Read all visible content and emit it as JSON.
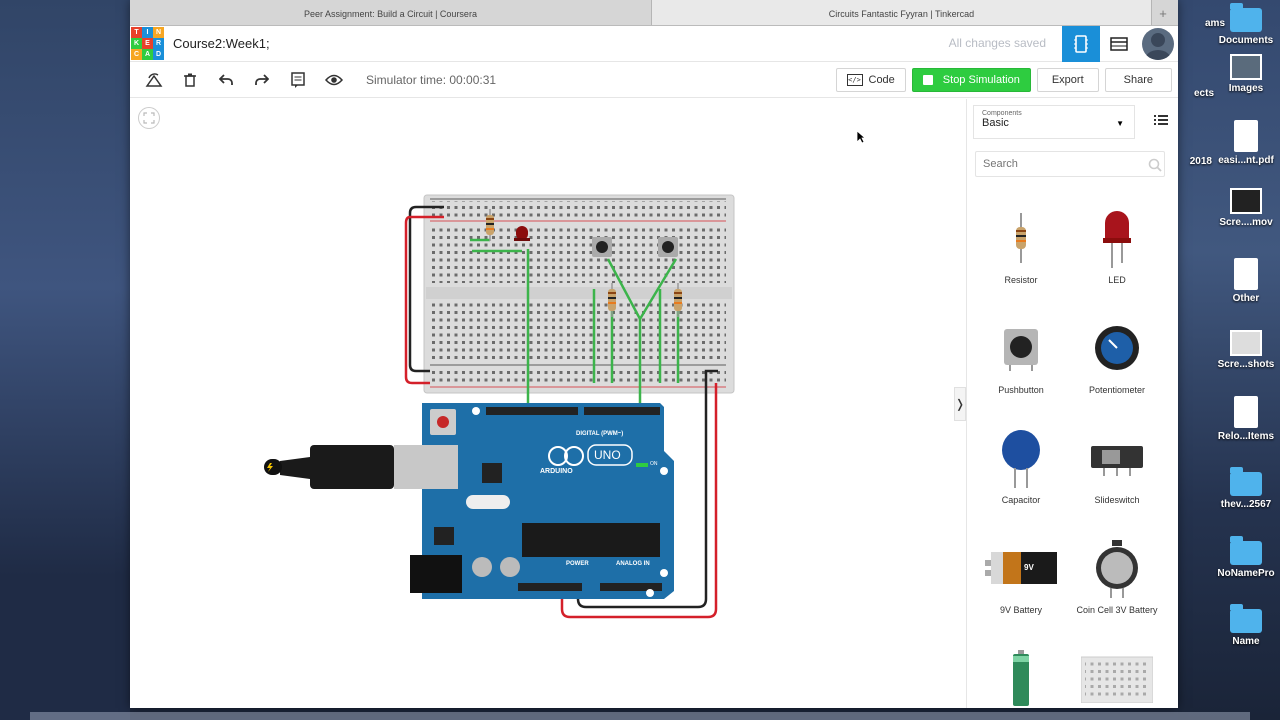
{
  "browser": {
    "tabs": [
      {
        "label": "Peer Assignment: Build a Circuit | Coursera",
        "active": false
      },
      {
        "label": "Circuits Fantastic Fyyran | Tinkercad",
        "active": true
      }
    ],
    "new_tab": "+"
  },
  "header": {
    "logo_letters": [
      "T",
      "I",
      "N",
      "K",
      "E",
      "R",
      "C",
      "A",
      "D"
    ],
    "logo_colors": [
      "#e8412b",
      "#1a8fd8",
      "#f6a623",
      "#2ecc40",
      "#e8412b",
      "#1a8fd8",
      "#f6a623",
      "#2ecc40",
      "#1a8fd8"
    ],
    "project_title": "Course2:Week1;",
    "save_status": "All changes saved"
  },
  "toolbar": {
    "simulator_time": "Simulator time: 00:00:31",
    "code_label": "Code",
    "stop_label": "Stop Simulation",
    "export_label": "Export",
    "share_label": "Share"
  },
  "panel": {
    "components_label": "Components",
    "components_value": "Basic",
    "search_placeholder": "Search",
    "components": [
      {
        "name": "Resistor",
        "icon": "resistor-icon"
      },
      {
        "name": "LED",
        "icon": "led-icon"
      },
      {
        "name": "Pushbutton",
        "icon": "pushbutton-icon"
      },
      {
        "name": "Potentiometer",
        "icon": "potentiometer-icon"
      },
      {
        "name": "Capacitor",
        "icon": "capacitor-icon"
      },
      {
        "name": "Slideswitch",
        "icon": "slideswitch-icon"
      },
      {
        "name": "9V Battery",
        "icon": "battery-9v-icon"
      },
      {
        "name": "Coin Cell 3V Battery",
        "icon": "coin-cell-icon"
      }
    ],
    "battery_label": "9V"
  },
  "circuit": {
    "board_brand": "ARDUINO",
    "board_model": "UNO",
    "digital_label": "DIGITAL (PWM~)",
    "power_label": "POWER",
    "analog_label": "ANALOG IN",
    "on_label": "ON"
  },
  "desktop": {
    "items": [
      {
        "label": "ams",
        "type": "folder"
      },
      {
        "label": "Documents",
        "type": "folder"
      },
      {
        "label": "ects",
        "type": "folder"
      },
      {
        "label": "Images",
        "type": "image"
      },
      {
        "label": "2018",
        "type": "doc"
      },
      {
        "label": "easi...nt.pdf",
        "type": "doc"
      },
      {
        "label": "Scre....mov",
        "type": "image"
      },
      {
        "label": "Other",
        "type": "doc"
      },
      {
        "label": "Scre...shots",
        "type": "image"
      },
      {
        "label": "Relo...Items",
        "type": "doc"
      },
      {
        "label": "thev...2567",
        "type": "folder"
      },
      {
        "label": "NoNamePro",
        "type": "folder"
      },
      {
        "label": "Name",
        "type": "folder"
      }
    ]
  },
  "colors": {
    "accent": "#1a8fd8",
    "stop_green": "#2ecc40",
    "arduino_blue": "#1e6fa8",
    "wire_green": "#3cb44b",
    "wire_red": "#d4202a"
  }
}
